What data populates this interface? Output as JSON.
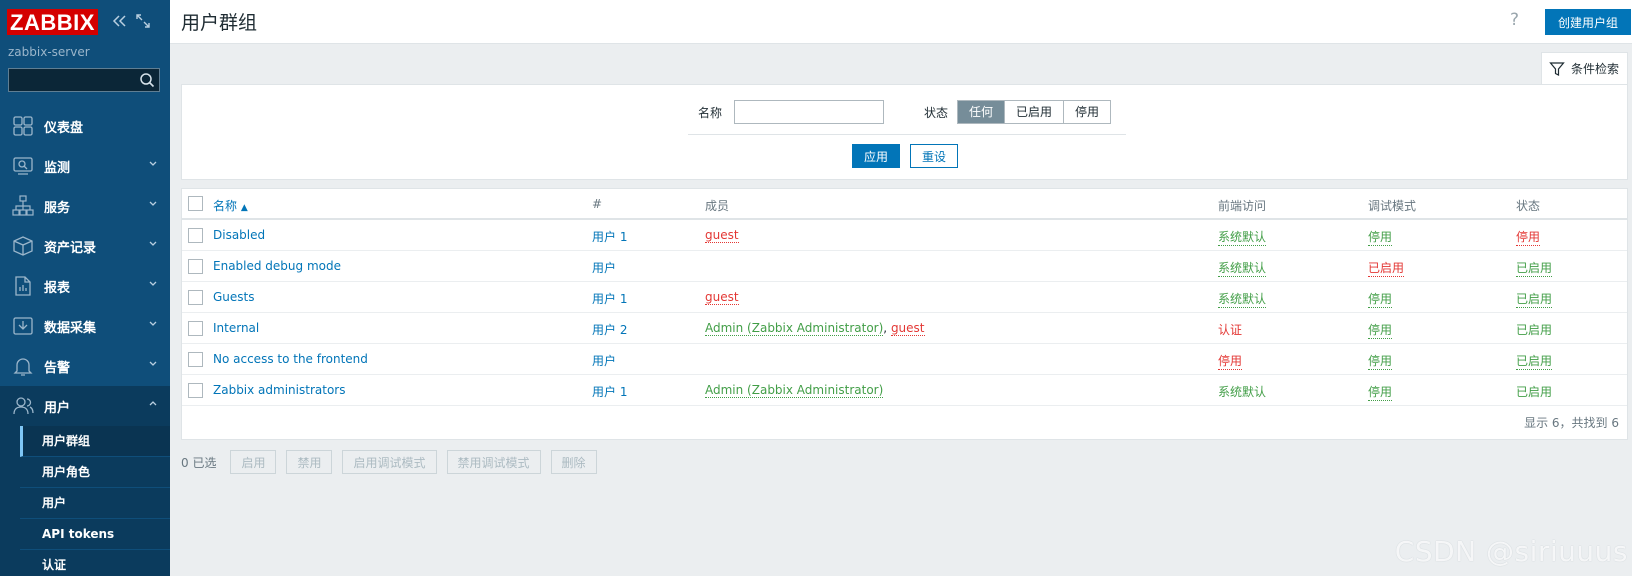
{
  "sidebar": {
    "logo": "ZABBIX",
    "server": "zabbix-server",
    "search_placeholder": "",
    "menu": [
      {
        "label": "仪表盘",
        "icon": "dashboard-icon"
      },
      {
        "label": "监测",
        "icon": "monitoring-icon"
      },
      {
        "label": "服务",
        "icon": "services-icon"
      },
      {
        "label": "资产记录",
        "icon": "inventory-icon"
      },
      {
        "label": "报表",
        "icon": "reports-icon"
      },
      {
        "label": "数据采集",
        "icon": "data-collection-icon"
      },
      {
        "label": "告警",
        "icon": "alerts-icon"
      },
      {
        "label": "用户",
        "icon": "users-icon"
      }
    ],
    "submenu": [
      "用户群组",
      "用户角色",
      "用户",
      "API tokens",
      "认证"
    ]
  },
  "header": {
    "title": "用户群组",
    "help": "?",
    "create_button": "创建用户组"
  },
  "filter": {
    "tab_label": "条件检索",
    "name_label": "名称",
    "name_value": "",
    "status_label": "状态",
    "status_options": [
      "任何",
      "已启用",
      "停用"
    ],
    "status_selected": "任何",
    "apply": "应用",
    "reset": "重设"
  },
  "table": {
    "headers": {
      "name": "名称",
      "count": "#",
      "members": "成员",
      "frontend": "前端访问",
      "debug": "调试模式",
      "status": "状态"
    },
    "rows": [
      {
        "name": "Disabled",
        "count": "用户 1",
        "members": [
          {
            "text": "guest",
            "color": "red"
          }
        ],
        "frontend": "系统默认",
        "debug": "停用",
        "status": "停用"
      },
      {
        "name": "Enabled debug mode",
        "count": "用户",
        "members": [],
        "frontend": "系统默认",
        "debug": "已启用",
        "status": "已启用"
      },
      {
        "name": "Guests",
        "count": "用户 1",
        "members": [
          {
            "text": "guest",
            "color": "red"
          }
        ],
        "frontend": "系统默认",
        "debug": "停用",
        "status": "已启用"
      },
      {
        "name": "Internal",
        "count": "用户 2",
        "members": [
          {
            "text": "Admin (Zabbix Administrator)",
            "color": "green"
          },
          {
            "text": "guest",
            "color": "red"
          }
        ],
        "frontend": "认证",
        "debug": "停用",
        "status": "已启用"
      },
      {
        "name": "No access to the frontend",
        "count": "用户",
        "members": [],
        "frontend": "停用",
        "debug": "停用",
        "status": "已启用"
      },
      {
        "name": "Zabbix administrators",
        "count": "用户 1",
        "members": [
          {
            "text": "Admin (Zabbix Administrator)",
            "color": "green"
          }
        ],
        "frontend": "系统默认",
        "debug": "停用",
        "status": "已启用"
      }
    ],
    "footer": "显示 6，共找到 6"
  },
  "actions": {
    "selected": "0 已选",
    "buttons": [
      "启用",
      "禁用",
      "启用调试模式",
      "禁用调试模式",
      "删除"
    ]
  },
  "colors": {
    "sidebar": "#0f4e7a",
    "accent": "#0275b8",
    "green": "#429e47",
    "red": "#e33734"
  },
  "watermark": "CSDN @siriuuus"
}
